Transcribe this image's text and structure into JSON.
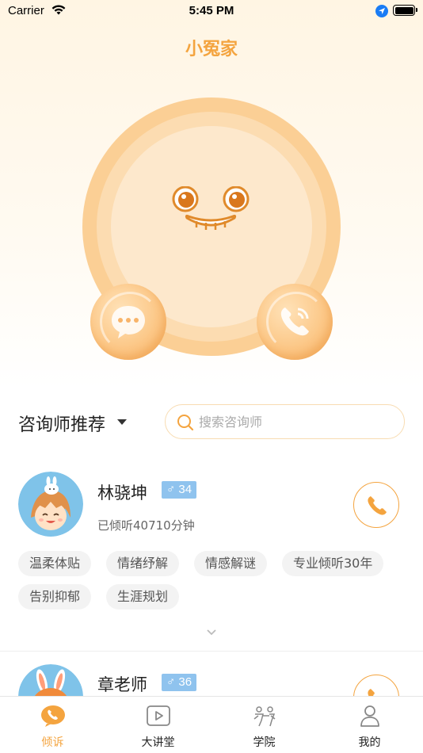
{
  "status_bar": {
    "carrier": "Carrier",
    "time": "5:45 PM"
  },
  "app": {
    "title": "小冤家"
  },
  "recommend": {
    "title": "咨询师推荐",
    "search_placeholder": "搜索咨询师"
  },
  "counselors": [
    {
      "name": "林骁坤",
      "gender_symbol": "♂",
      "age": "34",
      "listened": "已倾听40710分钟",
      "tags": [
        "温柔体贴",
        "情绪纾解",
        "情感解谜",
        "专业倾听30年",
        "告别抑郁",
        "生涯规划"
      ]
    },
    {
      "name": "章老师",
      "gender_symbol": "♂",
      "age": "36"
    }
  ],
  "tabs": [
    {
      "label": "倾诉",
      "icon": "phone-icon",
      "active": true
    },
    {
      "label": "大讲堂",
      "icon": "play-icon",
      "active": false
    },
    {
      "label": "学院",
      "icon": "academy-icon",
      "active": false
    },
    {
      "label": "我的",
      "icon": "person-icon",
      "active": false
    }
  ],
  "colors": {
    "accent": "#f4a43f",
    "badge": "#8fc3ee",
    "mascot": "#fbcf95"
  }
}
